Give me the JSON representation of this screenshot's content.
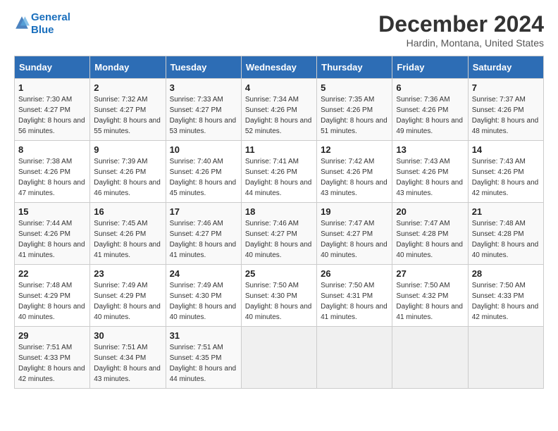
{
  "header": {
    "logo_line1": "General",
    "logo_line2": "Blue",
    "title": "December 2024",
    "subtitle": "Hardin, Montana, United States"
  },
  "calendar": {
    "headers": [
      "Sunday",
      "Monday",
      "Tuesday",
      "Wednesday",
      "Thursday",
      "Friday",
      "Saturday"
    ],
    "weeks": [
      [
        {
          "day": "1",
          "sunrise": "7:30 AM",
          "sunset": "4:27 PM",
          "daylight": "8 hours and 56 minutes."
        },
        {
          "day": "2",
          "sunrise": "7:32 AM",
          "sunset": "4:27 PM",
          "daylight": "8 hours and 55 minutes."
        },
        {
          "day": "3",
          "sunrise": "7:33 AM",
          "sunset": "4:27 PM",
          "daylight": "8 hours and 53 minutes."
        },
        {
          "day": "4",
          "sunrise": "7:34 AM",
          "sunset": "4:26 PM",
          "daylight": "8 hours and 52 minutes."
        },
        {
          "day": "5",
          "sunrise": "7:35 AM",
          "sunset": "4:26 PM",
          "daylight": "8 hours and 51 minutes."
        },
        {
          "day": "6",
          "sunrise": "7:36 AM",
          "sunset": "4:26 PM",
          "daylight": "8 hours and 49 minutes."
        },
        {
          "day": "7",
          "sunrise": "7:37 AM",
          "sunset": "4:26 PM",
          "daylight": "8 hours and 48 minutes."
        }
      ],
      [
        {
          "day": "8",
          "sunrise": "7:38 AM",
          "sunset": "4:26 PM",
          "daylight": "8 hours and 47 minutes."
        },
        {
          "day": "9",
          "sunrise": "7:39 AM",
          "sunset": "4:26 PM",
          "daylight": "8 hours and 46 minutes."
        },
        {
          "day": "10",
          "sunrise": "7:40 AM",
          "sunset": "4:26 PM",
          "daylight": "8 hours and 45 minutes."
        },
        {
          "day": "11",
          "sunrise": "7:41 AM",
          "sunset": "4:26 PM",
          "daylight": "8 hours and 44 minutes."
        },
        {
          "day": "12",
          "sunrise": "7:42 AM",
          "sunset": "4:26 PM",
          "daylight": "8 hours and 43 minutes."
        },
        {
          "day": "13",
          "sunrise": "7:43 AM",
          "sunset": "4:26 PM",
          "daylight": "8 hours and 43 minutes."
        },
        {
          "day": "14",
          "sunrise": "7:43 AM",
          "sunset": "4:26 PM",
          "daylight": "8 hours and 42 minutes."
        }
      ],
      [
        {
          "day": "15",
          "sunrise": "7:44 AM",
          "sunset": "4:26 PM",
          "daylight": "8 hours and 41 minutes."
        },
        {
          "day": "16",
          "sunrise": "7:45 AM",
          "sunset": "4:26 PM",
          "daylight": "8 hours and 41 minutes."
        },
        {
          "day": "17",
          "sunrise": "7:46 AM",
          "sunset": "4:27 PM",
          "daylight": "8 hours and 41 minutes."
        },
        {
          "day": "18",
          "sunrise": "7:46 AM",
          "sunset": "4:27 PM",
          "daylight": "8 hours and 40 minutes."
        },
        {
          "day": "19",
          "sunrise": "7:47 AM",
          "sunset": "4:27 PM",
          "daylight": "8 hours and 40 minutes."
        },
        {
          "day": "20",
          "sunrise": "7:47 AM",
          "sunset": "4:28 PM",
          "daylight": "8 hours and 40 minutes."
        },
        {
          "day": "21",
          "sunrise": "7:48 AM",
          "sunset": "4:28 PM",
          "daylight": "8 hours and 40 minutes."
        }
      ],
      [
        {
          "day": "22",
          "sunrise": "7:48 AM",
          "sunset": "4:29 PM",
          "daylight": "8 hours and 40 minutes."
        },
        {
          "day": "23",
          "sunrise": "7:49 AM",
          "sunset": "4:29 PM",
          "daylight": "8 hours and 40 minutes."
        },
        {
          "day": "24",
          "sunrise": "7:49 AM",
          "sunset": "4:30 PM",
          "daylight": "8 hours and 40 minutes."
        },
        {
          "day": "25",
          "sunrise": "7:50 AM",
          "sunset": "4:30 PM",
          "daylight": "8 hours and 40 minutes."
        },
        {
          "day": "26",
          "sunrise": "7:50 AM",
          "sunset": "4:31 PM",
          "daylight": "8 hours and 41 minutes."
        },
        {
          "day": "27",
          "sunrise": "7:50 AM",
          "sunset": "4:32 PM",
          "daylight": "8 hours and 41 minutes."
        },
        {
          "day": "28",
          "sunrise": "7:50 AM",
          "sunset": "4:33 PM",
          "daylight": "8 hours and 42 minutes."
        }
      ],
      [
        {
          "day": "29",
          "sunrise": "7:51 AM",
          "sunset": "4:33 PM",
          "daylight": "8 hours and 42 minutes."
        },
        {
          "day": "30",
          "sunrise": "7:51 AM",
          "sunset": "4:34 PM",
          "daylight": "8 hours and 43 minutes."
        },
        {
          "day": "31",
          "sunrise": "7:51 AM",
          "sunset": "4:35 PM",
          "daylight": "8 hours and 44 minutes."
        },
        null,
        null,
        null,
        null
      ]
    ]
  }
}
